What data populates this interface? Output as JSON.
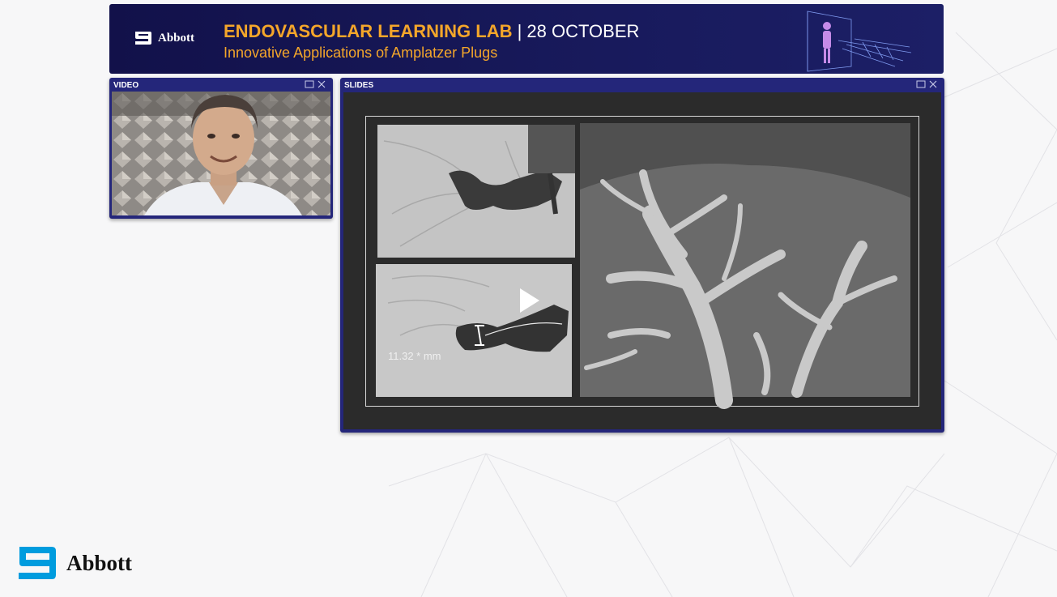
{
  "banner": {
    "brand": "Abbott",
    "title": "ENDOVASCULAR LEARNING LAB",
    "date": " | 28 OCTOBER",
    "subtitle": "Innovative Applications of Amplatzer Plugs"
  },
  "video_panel": {
    "title": "VIDEO"
  },
  "slides_panel": {
    "title": "SLIDES",
    "measurement": "11.32 * mm"
  },
  "footer": {
    "brand": "Abbott"
  },
  "colors": {
    "banner_bg": "#12114a",
    "accent_orange": "#f4a62a",
    "window_frame": "#24267a",
    "abbott_blue": "#009cde"
  }
}
